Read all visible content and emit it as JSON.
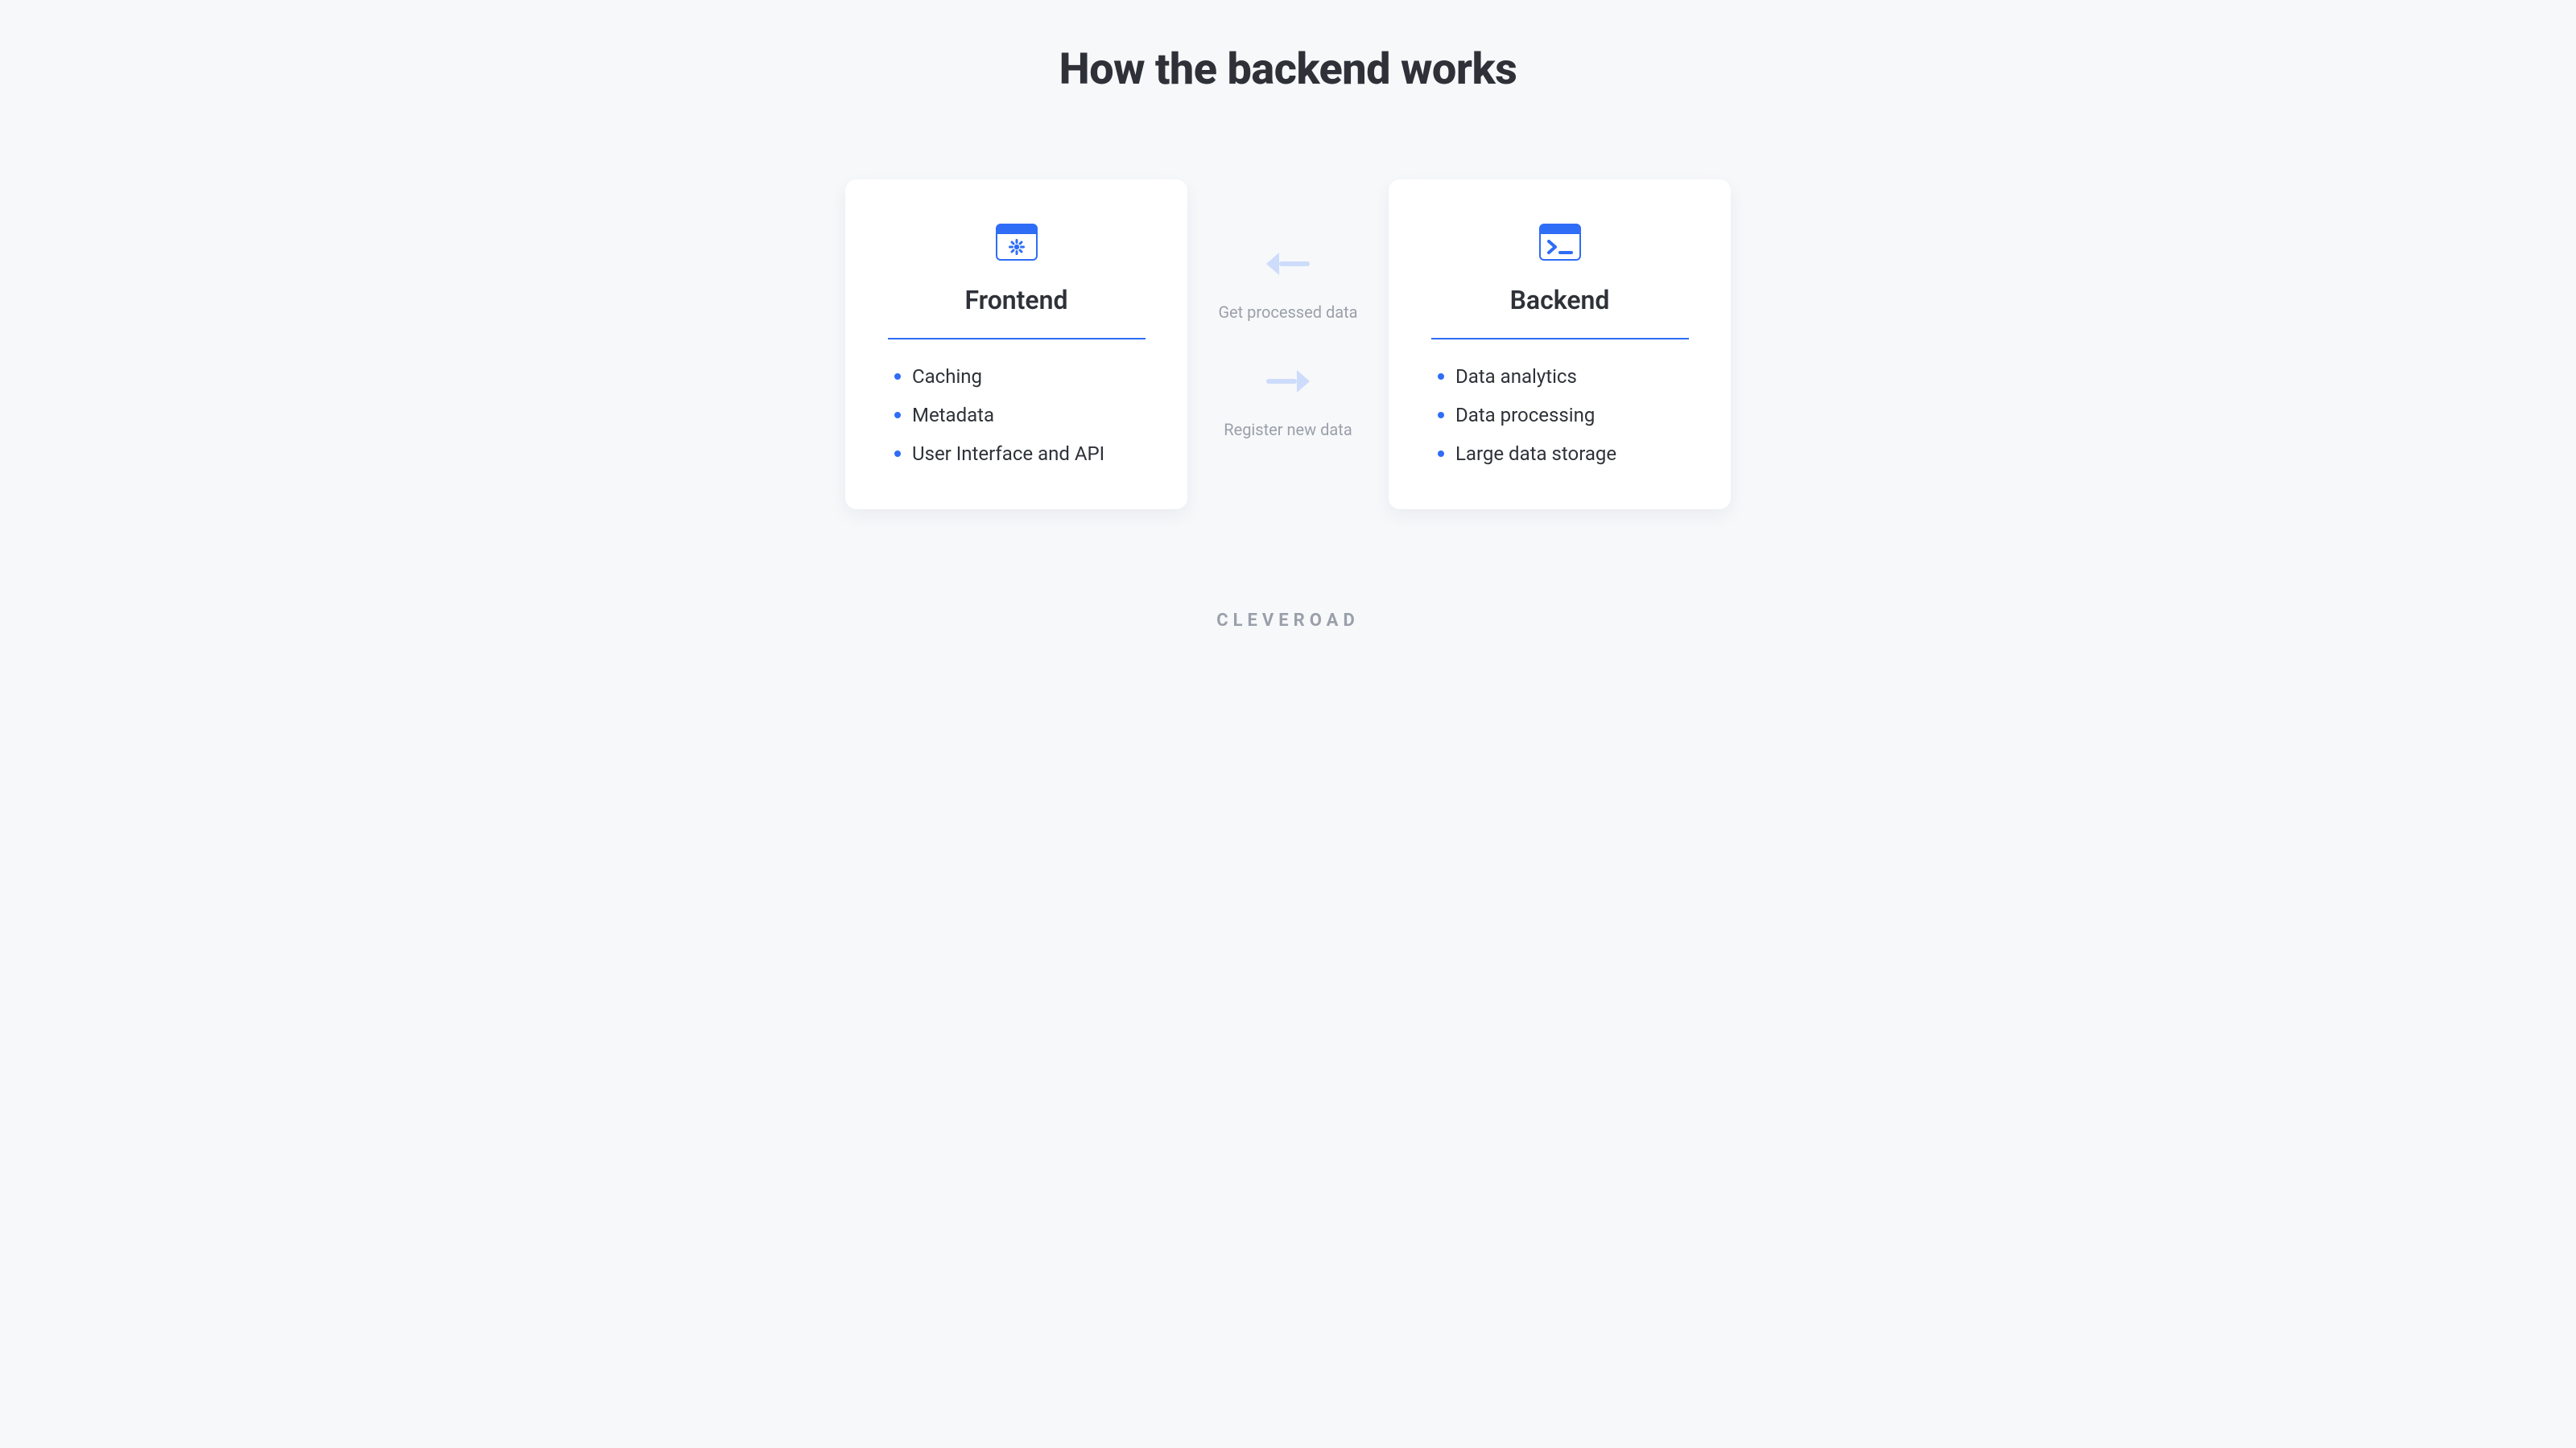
{
  "title": "How the backend works",
  "frontend": {
    "heading": "Frontend",
    "icon": "settings-window-icon",
    "items": [
      "Caching",
      "Metadata",
      "User Interface and API"
    ]
  },
  "backend": {
    "heading": "Backend",
    "icon": "terminal-window-icon",
    "items": [
      "Data analytics",
      "Data processing",
      "Large data storage"
    ]
  },
  "exchanges": {
    "to_frontend": "Get processed data",
    "to_backend": "Register new data"
  },
  "brand": "CLEVEROAD",
  "colors": {
    "accent": "#2f6df6",
    "arrow": "#cddcfa",
    "text": "#2e3238",
    "muted": "#9aa0aa",
    "bg": "#f7f8fa",
    "card": "#ffffff"
  }
}
